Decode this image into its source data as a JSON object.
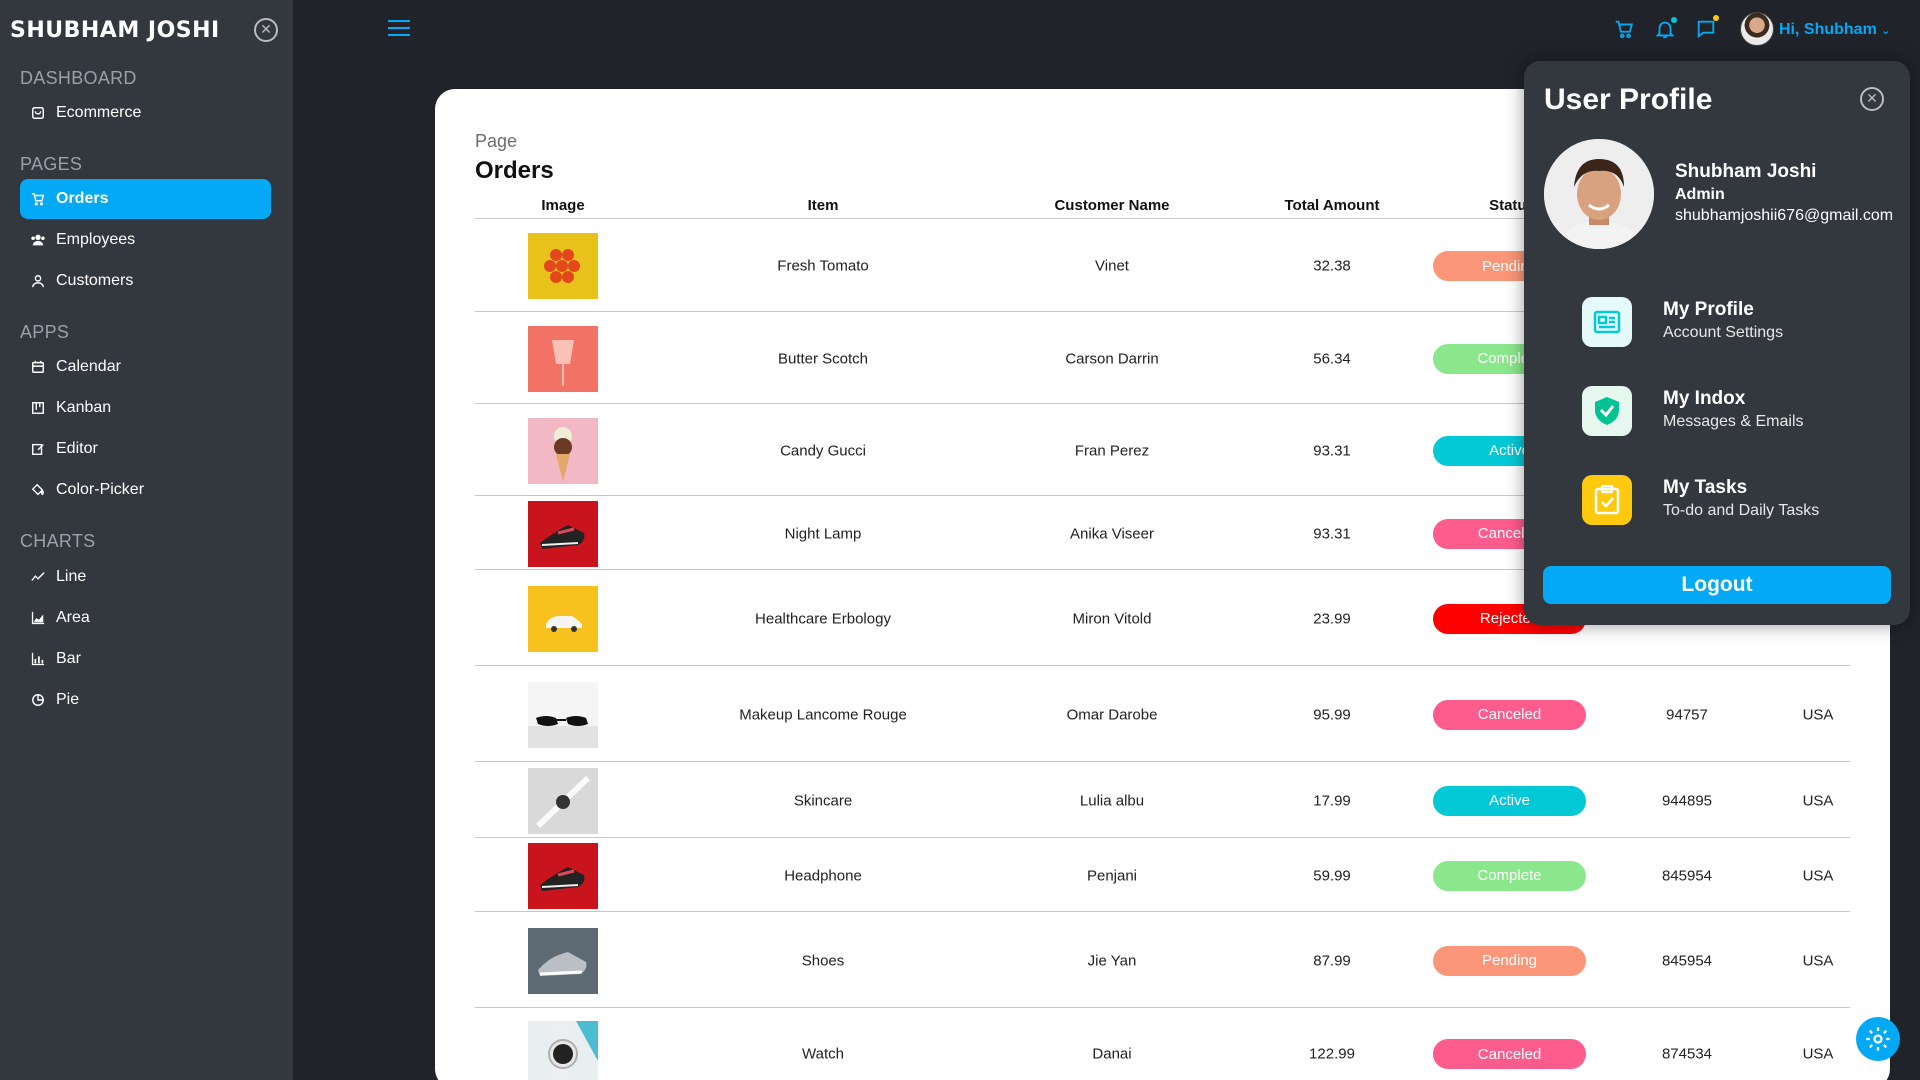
{
  "brand": "SHUBHAM JOSHI",
  "sidebar": {
    "sections": [
      {
        "title": "DASHBOARD",
        "items": [
          {
            "label": "Ecommerce",
            "icon": "shopping-bag-icon"
          }
        ]
      },
      {
        "title": "PAGES",
        "items": [
          {
            "label": "Orders",
            "icon": "cart-icon"
          },
          {
            "label": "Employees",
            "icon": "people-icon"
          },
          {
            "label": "Customers",
            "icon": "user-icon"
          }
        ]
      },
      {
        "title": "APPS",
        "items": [
          {
            "label": "Calendar",
            "icon": "calendar-icon"
          },
          {
            "label": "Kanban",
            "icon": "kanban-icon"
          },
          {
            "label": "Editor",
            "icon": "edit-icon"
          },
          {
            "label": "Color-Picker",
            "icon": "paint-bucket-icon"
          }
        ]
      },
      {
        "title": "CHARTS",
        "items": [
          {
            "label": "Line",
            "icon": "line-chart-icon"
          },
          {
            "label": "Area",
            "icon": "area-chart-icon"
          },
          {
            "label": "Bar",
            "icon": "bar-chart-icon"
          },
          {
            "label": "Pie",
            "icon": "pie-chart-icon"
          }
        ]
      }
    ],
    "active": "Orders"
  },
  "topbar": {
    "greeting_prefix": "Hi,",
    "greeting_name": "Shubham",
    "accent": "#03a9f4"
  },
  "main": {
    "page_label": "Page",
    "title": "Orders",
    "columns": [
      "Image",
      "Item",
      "Customer Name",
      "Total Amount",
      "Status"
    ],
    "rows": [
      {
        "item": "Fresh Tomato",
        "customer": "Vinet",
        "amount": "32.38",
        "status": "Pending",
        "id": "",
        "location": "",
        "thumb": "tomato"
      },
      {
        "item": "Butter Scotch",
        "customer": "Carson Darrin",
        "amount": "56.34",
        "status": "Complete",
        "id": "",
        "location": "",
        "thumb": "cup"
      },
      {
        "item": "Candy Gucci",
        "customer": "Fran Perez",
        "amount": "93.31",
        "status": "Active",
        "id": "",
        "location": "",
        "thumb": "icecream"
      },
      {
        "item": "Night Lamp",
        "customer": "Anika Viseer",
        "amount": "93.31",
        "status": "Canceled",
        "id": "",
        "location": "",
        "thumb": "shoe-red"
      },
      {
        "item": "Healthcare Erbology",
        "customer": "Miron Vitold",
        "amount": "23.99",
        "status": "Rejected",
        "id": "",
        "location": "",
        "thumb": "car"
      },
      {
        "item": "Makeup Lancome Rouge",
        "customer": "Omar Darobe",
        "amount": "95.99",
        "status": "Canceled",
        "id": "94757",
        "location": "USA",
        "thumb": "glasses"
      },
      {
        "item": "Skincare",
        "customer": "Lulia albu",
        "amount": "17.99",
        "status": "Active",
        "id": "944895",
        "location": "USA",
        "thumb": "watch-grey"
      },
      {
        "item": "Headphone",
        "customer": "Penjani",
        "amount": "59.99",
        "status": "Complete",
        "id": "845954",
        "location": "USA",
        "thumb": "shoe-red"
      },
      {
        "item": "Shoes",
        "customer": "Jie Yan",
        "amount": "87.99",
        "status": "Pending",
        "id": "845954",
        "location": "USA",
        "thumb": "sneaker"
      },
      {
        "item": "Watch",
        "customer": "Danai",
        "amount": "122.99",
        "status": "Canceled",
        "id": "874534",
        "location": "USA",
        "thumb": "smartwatch"
      }
    ],
    "status_colors": {
      "Pending": "#fb9678",
      "Complete": "#8be78b",
      "Active": "#03c9d7",
      "Canceled": "#ff5c8e",
      "Rejected": "#ff0000"
    }
  },
  "profile": {
    "title": "User Profile",
    "name": "Shubham Joshi",
    "role": "Admin",
    "email": "shubhamjoshii676@gmail.com",
    "items": [
      {
        "title": "My Profile",
        "subtitle": "Account Settings",
        "icon": "id-card-icon",
        "bg": "#e5fafb",
        "fg": "#03c9d7"
      },
      {
        "title": "My Indox",
        "subtitle": "Messages & Emails",
        "icon": "shield-icon",
        "bg": "#e6f7f0",
        "fg": "#00c292"
      },
      {
        "title": "My Tasks",
        "subtitle": "To-do and Daily Tasks",
        "icon": "clipboard-icon",
        "bg": "#fef4e1",
        "fg": "#ffb300"
      }
    ],
    "logout": "Logout"
  }
}
